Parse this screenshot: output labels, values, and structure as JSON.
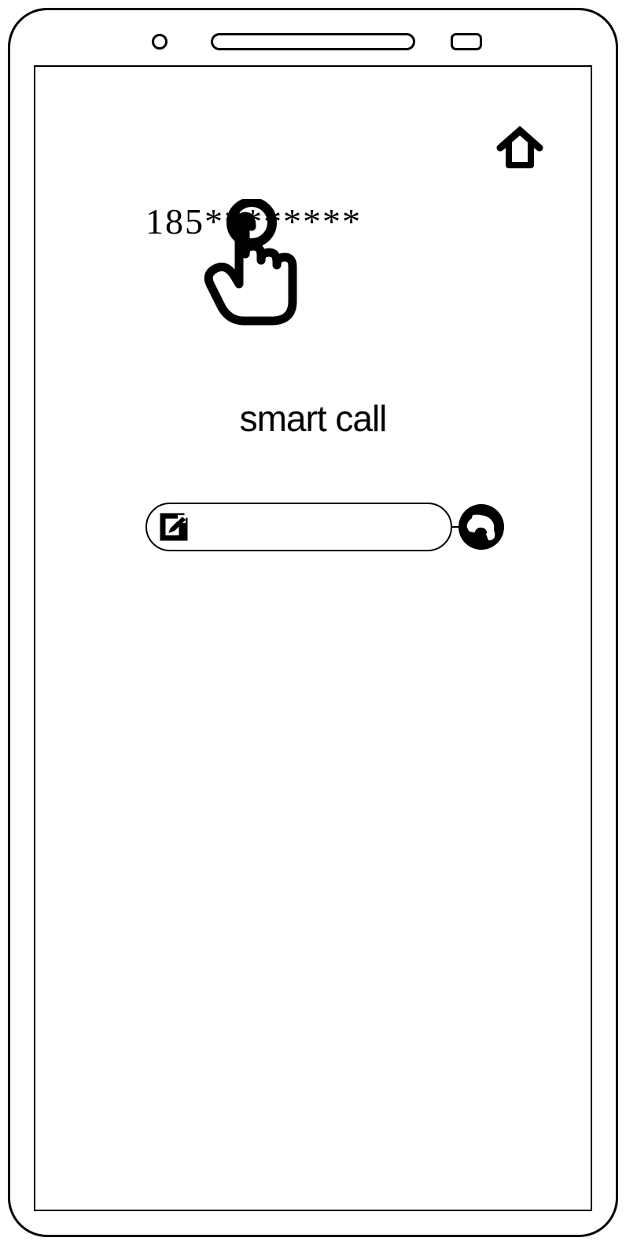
{
  "phone_number": "185********",
  "app_title": "smart call",
  "icons": {
    "home": "home-icon",
    "tap": "tap-hand-icon",
    "edit": "edit-icon",
    "dial": "dial-icon"
  }
}
